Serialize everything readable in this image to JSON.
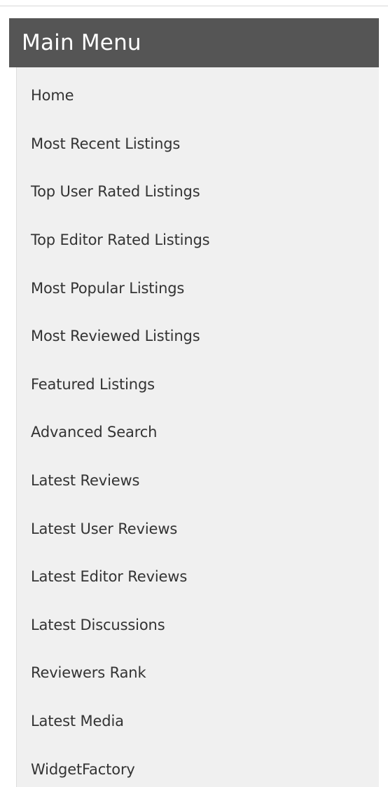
{
  "menu": {
    "title": "Main Menu",
    "items": [
      {
        "label": "Home"
      },
      {
        "label": "Most Recent Listings"
      },
      {
        "label": "Top User Rated Listings"
      },
      {
        "label": "Top Editor Rated Listings"
      },
      {
        "label": "Most Popular Listings"
      },
      {
        "label": "Most Reviewed Listings"
      },
      {
        "label": "Featured Listings"
      },
      {
        "label": "Advanced Search"
      },
      {
        "label": "Latest Reviews"
      },
      {
        "label": "Latest User Reviews"
      },
      {
        "label": "Latest Editor Reviews"
      },
      {
        "label": "Latest Discussions"
      },
      {
        "label": "Reviewers Rank"
      },
      {
        "label": "Latest Media"
      },
      {
        "label": "WidgetFactory"
      }
    ]
  },
  "colors": {
    "header_bg": "#555555",
    "body_bg": "#f0f0f0",
    "text": "#333333"
  }
}
